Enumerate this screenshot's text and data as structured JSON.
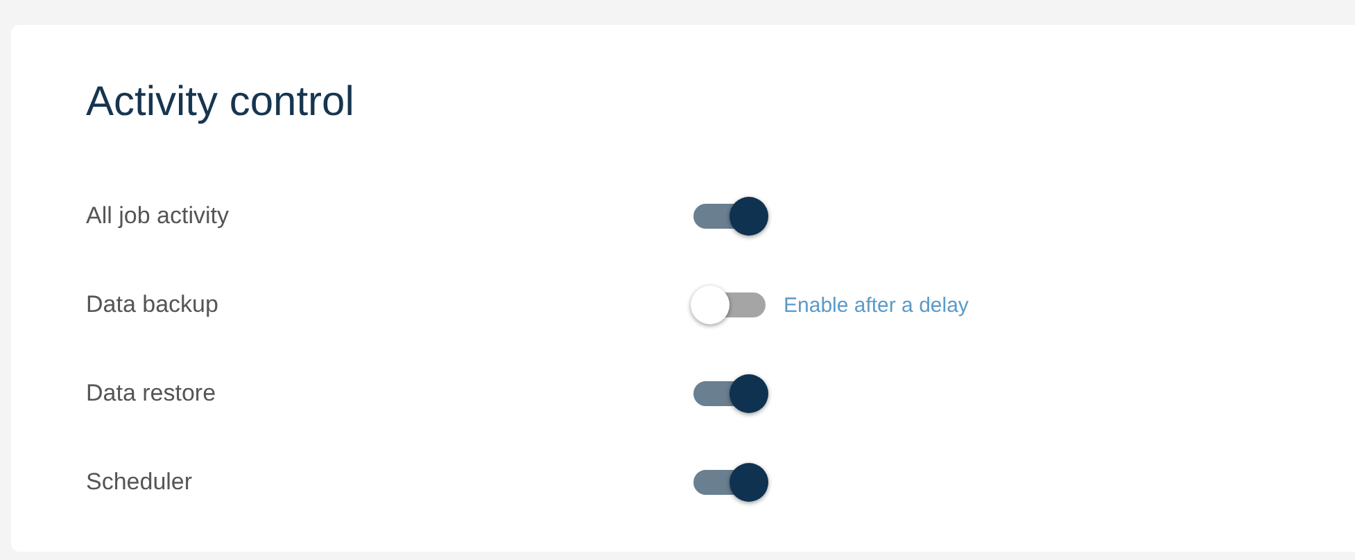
{
  "title": "Activity control",
  "items": [
    {
      "label": "All job activity",
      "on": true
    },
    {
      "label": "Data backup",
      "on": false,
      "link": "Enable after a delay"
    },
    {
      "label": "Data restore",
      "on": true
    },
    {
      "label": "Scheduler",
      "on": true
    }
  ]
}
